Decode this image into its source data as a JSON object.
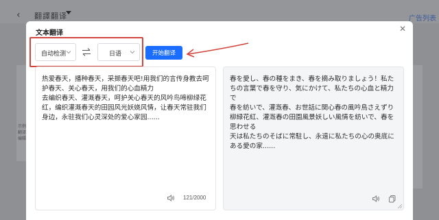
{
  "background": {
    "title": "翻譯翻译",
    "right_link": "广告列表",
    "side_text": "示例\n翻译\n编辑"
  },
  "modal": {
    "title": "文本翻译",
    "close_icon": "close-icon"
  },
  "languages": {
    "source": "自动检测",
    "target": "日语",
    "swap_icon": "swap-icon"
  },
  "start_button": "开始翻译",
  "source_panel": {
    "text": "热爱春天，播种春天，采撷春天吧!用我们的言传身教去呵护春天、关心春天，用我们的心血精力\n去编织春天、灌溉春天，呵护关心春天的风吟鸟啼柳绿花红，编织灌溉春天的田园风光妖娆风情，让春天常驻我们身边，永驻我们心灵深处的爱心家园......",
    "char_count": "121/2000"
  },
  "target_panel": {
    "text": "春を愛し、春の種をまき、春を摘み取りましょう！私たちの言葉で春を守り、気にかけて、私たちの心血と精力で\n春を紡いで、灌漑春、お世話に関心春の風吟鳥さえずり柳緑花紅、灌漑春の田園風景妖しい風情を紡いで、春を思わせる\n天は私たちのそばに常駐し、永遠に私たちの心の奥底にある愛の家......"
  },
  "colors": {
    "primary": "#1a6dff",
    "highlight": "#d2443c",
    "overlay": "#8f9093"
  }
}
